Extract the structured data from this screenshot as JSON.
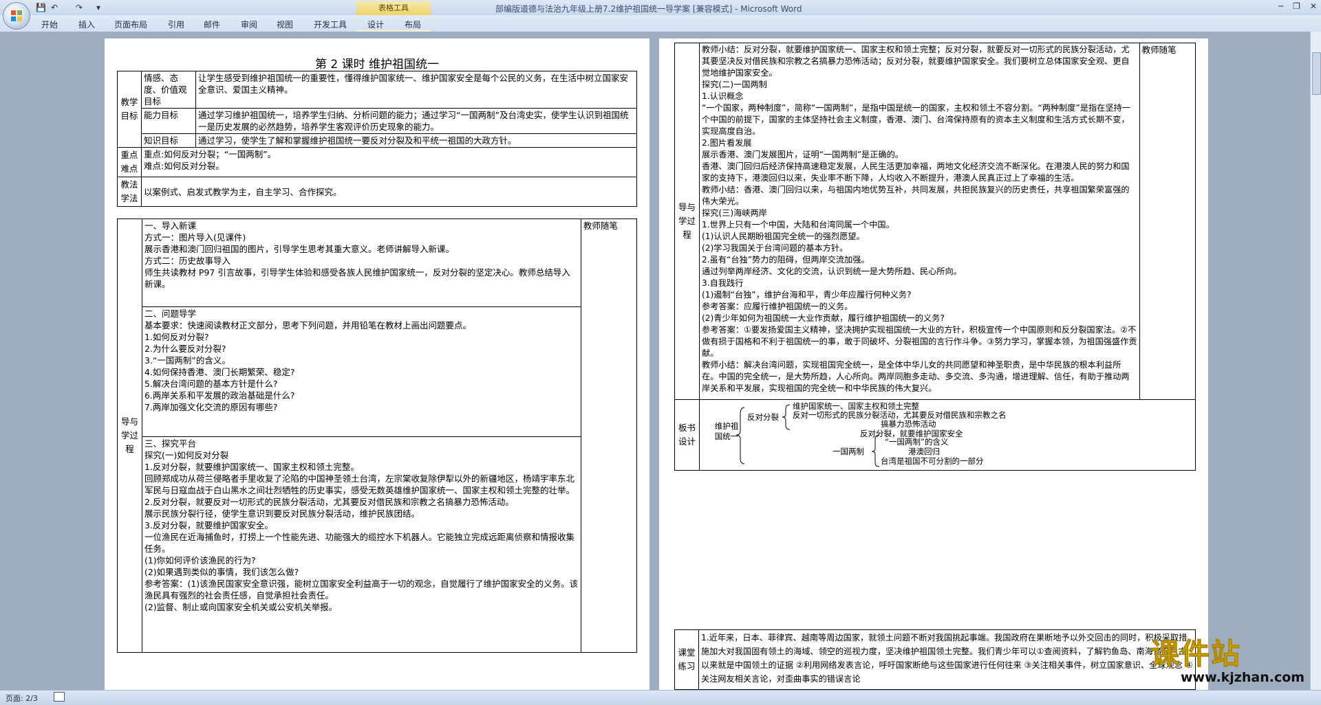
{
  "window": {
    "title": "部编版道德与法治九年级上册7.2维护祖国统一导学案 [兼容模式] - Microsoft Word",
    "context_tab_group": "表格工具"
  },
  "ribbon_tabs": [
    "开始",
    "插入",
    "页面布局",
    "引用",
    "邮件",
    "审阅",
    "视图",
    "开发工具",
    "设计",
    "布局"
  ],
  "status": {
    "page": "页面: 2/3"
  },
  "page1": {
    "heading": "第 2 课时    维护祖国统一",
    "goals_label": "教学目标",
    "goal_rows": [
      {
        "label": "情感、态度、价值观目标",
        "text": "让学生感受到维护祖国统一的重要性，懂得维护国家统一、维护国家安全是每个公民的义务，在生活中树立国家安全意识、爱国主义精神。"
      },
      {
        "label": "能力目标",
        "text": "通过学习维护祖国统一，培养学生归纳、分析问题的能力；通过学习“一国两制”及台湾史实，使学生认识到祖国统一是历史发展的必然趋势，培养学生客观评价历史现象的能力。"
      },
      {
        "label": "知识目标",
        "text": "通过学习，使学生了解和掌握维护祖国统一要反对分裂及和平统一祖国的大政方针。"
      }
    ],
    "key_label": "重点难点",
    "key_lines": [
      "重点:如何反对分裂；“一国两制”。",
      "难点:如何反对分裂。"
    ],
    "method_label": "教法学法",
    "method_text": "以案例式、启发式教学为主，自主学习、合作探究。",
    "process_label": "导与学过程",
    "notes_label": "教师随笔",
    "section1": [
      "一、导入新课",
      "方式一：图片导入(见课件)",
      "展示香港和澳门回归祖国的图片，引导学生思考其重大意义。老师讲解导入新课。",
      "方式二：历史故事导入",
      "师生共读教材 P97 引言故事，引导学生体验和感受各族人民维护国家统一，反对分裂的坚定决心。教师总结导入新课。"
    ],
    "section2": [
      "二、问题导学",
      "基本要求：快速阅读教材正文部分，思考下列问题，并用铅笔在教材上画出问题要点。",
      "1.如何反对分裂?",
      "2.为什么要反对分裂?",
      "3.“一国两制”的含义。",
      "4.如何保持香港、澳门长期繁荣、稳定?",
      "5.解决台湾问题的基本方针是什么?",
      "6.两岸关系和平发展的政治基础是什么?",
      "7.两岸加强文化交流的原因有哪些?"
    ],
    "section3": [
      "三、探究平台",
      "探究(一)如何反对分裂",
      "1.反对分裂，就要维护国家统一、国家主权和领土完整。",
      "回顾郑成功从荷兰侵略者手里收复了沦陷的中国神圣领土台湾，左宗棠收复除伊犁以外的新疆地区，杨靖宇率东北军民与日寇血战于白山黑水之间壮烈牺牲的历史事实，感受无数英雄维护国家统一、国家主权和领土完整的壮举。",
      "2.反对分裂，就要反对一切形式的民族分裂活动，尤其要反对借民族和宗教之名搞暴力恐怖活动。",
      "展示民族分裂行径，使学生意识到要反对民族分裂活动，维护民族团结。",
      "3.反对分裂，就要维护国家安全。",
      "一位渔民在近海捕鱼时，打捞上一个性能先进、功能强大的缆控水下机器人。它能独立完成远距离侦察和情报收集任务。",
      "(1)你如何评价该渔民的行为?",
      "(2)如果遇到类似的事情，我们该怎么做?",
      "参考答案：(1)该渔民国家安全意识强，能树立国家安全利益高于一切的观念，自觉履行了维护国家安全的义务。该渔民具有强烈的社会责任感，自觉承担社会责任。",
      "(2)监督、制止或向国家安全机关或公安机关举报。"
    ]
  },
  "page2": {
    "notes_label": "教师随笔",
    "process_label": "导与学过程",
    "process_lines": [
      "教师小结：反对分裂，就要维护国家统一、国家主权和领土完整；反对分裂，就要反对一切形式的民族分裂活动，尤其要坚决反对借民族和宗教之名搞暴力恐怖活动；反对分裂，就要维护国家安全。我们要树立总体国家安全观、更自觉地维护国家安全。",
      "探究(二)一国两制",
      "1.认识概念",
      "“一个国家，两种制度”，简称“一国两制”，是指中国是统一的国家，主权和领土不容分割。“两种制度”是指在坚持一个中国的前提下，国家的主体坚持社会主义制度，香港、澳门、台湾保持原有的资本主义制度和生活方式长期不变，实现高度自治。",
      "2.图片看发展",
      "展示香港、澳门发展图片，证明“一国两制”是正确的。",
      "香港、澳门回归后经济保持高速稳定发展，人民生活更加幸福，两地文化经济交流不断深化。在港澳人民的努力和国家的支持下，港澳回归以来，失业率不断下降，人均收入不断提升，港澳人民真正过上了幸福的生活。",
      "教师小结：香港、澳门回归以来，与祖国内地优势互补，共同发展，共担民族复兴的历史责任，共享祖国繁荣富强的伟大荣光。",
      "探究(三)海峡两岸",
      "1.世界上只有一个中国，大陆和台湾同属一个中国。",
      "(1)认识人民期盼祖国完全统一的强烈愿望。",
      "(2)学习我国关于台湾问题的基本方针。",
      "2.虽有“台独”势力的阻碍，但两岸交流加强。",
      "通过列举两岸经济、文化的交流，认识到统一是大势所趋、民心所向。",
      "3.自我践行",
      "(1)遏制“台独”，维护台海和平，青少年应履行何种义务?",
      "参考答案：应履行维护祖国统一的义务。",
      "(2)青少年如何为祖国统一大业作贡献，履行维护祖国统一的义务?",
      "参考答案：①要发扬爱国主义精神，坚决拥护实现祖国统一大业的方针，积极宣传一个中国原则和反分裂国家法。②不做有损于国格和不利于祖国统一的事，敢于同破坏、分裂祖国的言行作斗争。③努力学习，掌握本领，为祖国强盛作贡献。",
      "教师小结：解决台湾问题，实现祖国完全统一，是全体中华儿女的共同愿望和神圣职责，是中华民族的根本利益所在。中国的完全统一，是大势所趋，人心所向。两岸同胞多走动、多交流、多沟通，增进理解、信任，有助于推动两岸关系和平发展，实现祖国的完全统一和中华民族的伟大复兴。"
    ],
    "board_label": "板书设计",
    "board": {
      "root": "维护祖国统一",
      "b1": "反对分裂",
      "b1_items": [
        "维护国家统一、国家主权和领土完整",
        "反对一切形式的民族分裂活动，尤其要反对借民族和宗教之名",
        "搞暴力恐怖活动",
        "反对分裂，就要维护国家安全"
      ],
      "b2": "一国两制",
      "b2_items": [
        "“一国两制”的含义",
        "港澳回归",
        "台湾是祖国不可分割的一部分"
      ]
    },
    "practice_label": "课堂练习",
    "practice_text": "1.近年来，日本、菲律宾、越南等周边国家，就领土问题不断对我国挑起事端。我国政府在果断地予以外交回击的同时，积极采取措施加大对我国固有领土的海域、领空的巡视力度，坚决维护祖国领土完整。我们青少年可以①查阅资料，了解钓鱼岛、南海诸岛自古以来就是中国领土的证据  ②利用网络发表言论，呼吁国家断绝与这些国家进行任何往来  ③关注相关事件，树立国家意识、全球观念  ④关注网友相关言论，对歪曲事实的错误言论"
  },
  "watermark": {
    "text": "课件站",
    "url": "www.kjzhan.com"
  }
}
